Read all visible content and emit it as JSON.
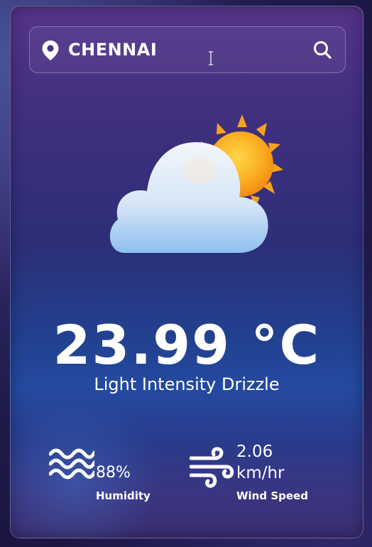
{
  "search": {
    "city_value": "CHENNAI",
    "location_icon": "map-pin-icon",
    "search_icon": "search-icon"
  },
  "weather": {
    "icon": "partly-cloudy-icon",
    "temperature": "23.99 °C",
    "description": "Light Intensity Drizzle"
  },
  "details": {
    "humidity": {
      "icon": "waves-icon",
      "value": "88%",
      "label": "Humidity"
    },
    "wind": {
      "icon": "wind-icon",
      "value_number": "2.06",
      "value_unit": "km/hr",
      "label": "Wind Speed"
    }
  },
  "colors": {
    "text": "#ffffff",
    "card_top": "#55348a",
    "card_mid": "#244aa0",
    "sun": "#f7a21b"
  }
}
